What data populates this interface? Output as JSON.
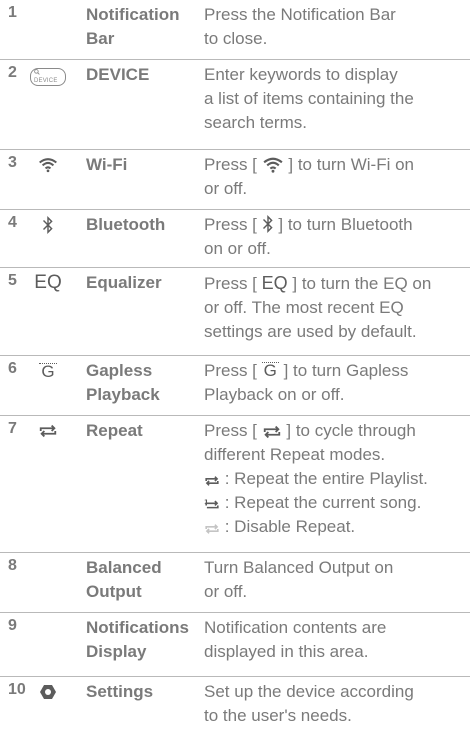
{
  "rows": [
    {
      "num": "1",
      "name1": "Notification",
      "name2": "Bar",
      "desc": [
        "Press the Notification Bar",
        "to close."
      ]
    },
    {
      "num": "2",
      "icon_label": "DEVICE",
      "name1": "DEVICE",
      "name2": "",
      "desc": [
        "Enter keywords to display",
        "a list of items containing the",
        "search terms."
      ]
    },
    {
      "num": "3",
      "name1": "Wi-Fi",
      "name2": "",
      "desc_pre": "Press [",
      "desc_post": "] to turn Wi-Fi on",
      "desc": [
        "or off."
      ]
    },
    {
      "num": "4",
      "name1": "Bluetooth",
      "name2": "",
      "desc_pre": "Press [",
      "desc_post": "] to turn Bluetooth",
      "desc": [
        "on or off."
      ]
    },
    {
      "num": "5",
      "icon_label": "EQ",
      "name1": "Equalizer",
      "name2": "",
      "desc_pre": "Press [",
      "desc_icon": "EQ",
      "desc_post": "] to turn the EQ on",
      "desc": [
        "or off. The most recent EQ",
        "settings are used by default."
      ]
    },
    {
      "num": "6",
      "icon_label": "G",
      "name1": "Gapless",
      "name2": "Playback",
      "desc_pre": "Press [",
      "desc_icon": "G",
      "desc_post": "] to turn Gapless",
      "desc": [
        "Playback on or off."
      ]
    },
    {
      "num": "7",
      "name1": "Repeat",
      "name2": "",
      "desc_pre": "Press [",
      "desc_post": "] to cycle through",
      "desc": [
        "different Repeat modes."
      ],
      "modes": [
        ": Repeat the entire Playlist.",
        ": Repeat the current song.",
        ": Disable Repeat."
      ]
    },
    {
      "num": "8",
      "name1": "Balanced",
      "name2": "Output",
      "desc": [
        "Turn Balanced Output on",
        "or off."
      ]
    },
    {
      "num": "9",
      "name1": "Notifications",
      "name2": "Display",
      "desc": [
        "Notification contents are",
        "displayed in this area."
      ]
    },
    {
      "num": "10",
      "name1": "Settings",
      "name2": "",
      "desc": [
        "Set up the device according",
        "to the user's needs."
      ]
    }
  ],
  "colors": {
    "text": "#7a7a7a",
    "icon": "#5c5c5c",
    "divider": "#b9b9b9"
  },
  "icons": [
    "search-icon",
    "wifi-icon",
    "bluetooth-icon",
    "repeat-icon",
    "repeat-one-icon",
    "settings-icon"
  ]
}
